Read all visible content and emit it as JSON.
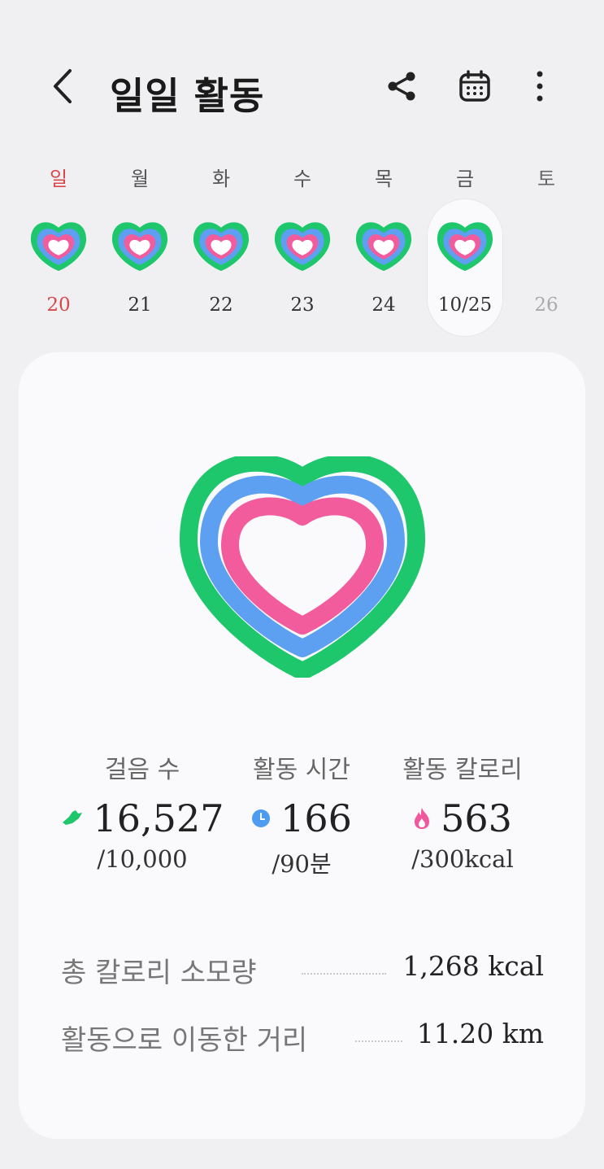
{
  "header": {
    "title": "일일 활동",
    "icons": [
      "back-icon",
      "share-icon",
      "calendar-icon",
      "more-icon"
    ]
  },
  "week": [
    {
      "weekday": "일",
      "date": "20",
      "ring": true
    },
    {
      "weekday": "월",
      "date": "21",
      "ring": true
    },
    {
      "weekday": "화",
      "date": "22",
      "ring": true
    },
    {
      "weekday": "수",
      "date": "23",
      "ring": true
    },
    {
      "weekday": "목",
      "date": "24",
      "ring": true
    },
    {
      "weekday": "금",
      "date": "10/25",
      "ring": true,
      "selected": true
    },
    {
      "weekday": "토",
      "date": "26",
      "ring": false
    }
  ],
  "stats": {
    "steps": {
      "label": "걸음 수",
      "value": "16,527",
      "goal": "/10,000",
      "icon": "shoe-icon",
      "color": "#1fc66a"
    },
    "active_time": {
      "label": "활동 시간",
      "value": "166",
      "goal": "/90분",
      "icon": "clock-icon",
      "color": "#4d9cf0"
    },
    "active_calories": {
      "label": "활동 칼로리",
      "value": "563",
      "goal": "/300kcal",
      "icon": "flame-icon",
      "color": "#f0579d"
    }
  },
  "summary": {
    "total_calories": {
      "label": "총 칼로리 소모량",
      "value": "1,268 kcal"
    },
    "distance": {
      "label": "활동으로 이동한 거리",
      "value": "11.20 km"
    }
  },
  "colors": {
    "ring_outer": "#1ec66c",
    "ring_middle": "#5da0f2",
    "ring_inner": "#f25c9d",
    "sunday": "#d8474a"
  }
}
